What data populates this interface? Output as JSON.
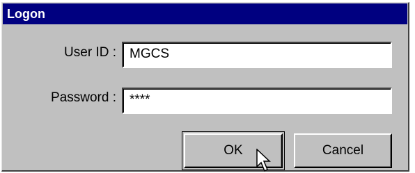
{
  "window": {
    "title": "Logon"
  },
  "form": {
    "user_id_label": "User ID :",
    "user_id_value": "MGCS",
    "password_label": "Password :",
    "password_value": "****"
  },
  "buttons": {
    "ok_label": "OK",
    "cancel_label": "Cancel"
  },
  "colors": {
    "titlebar": "#000080",
    "dialog_face": "#c0c0c0"
  },
  "icons": {
    "cursor": "mouse-pointer-icon"
  }
}
